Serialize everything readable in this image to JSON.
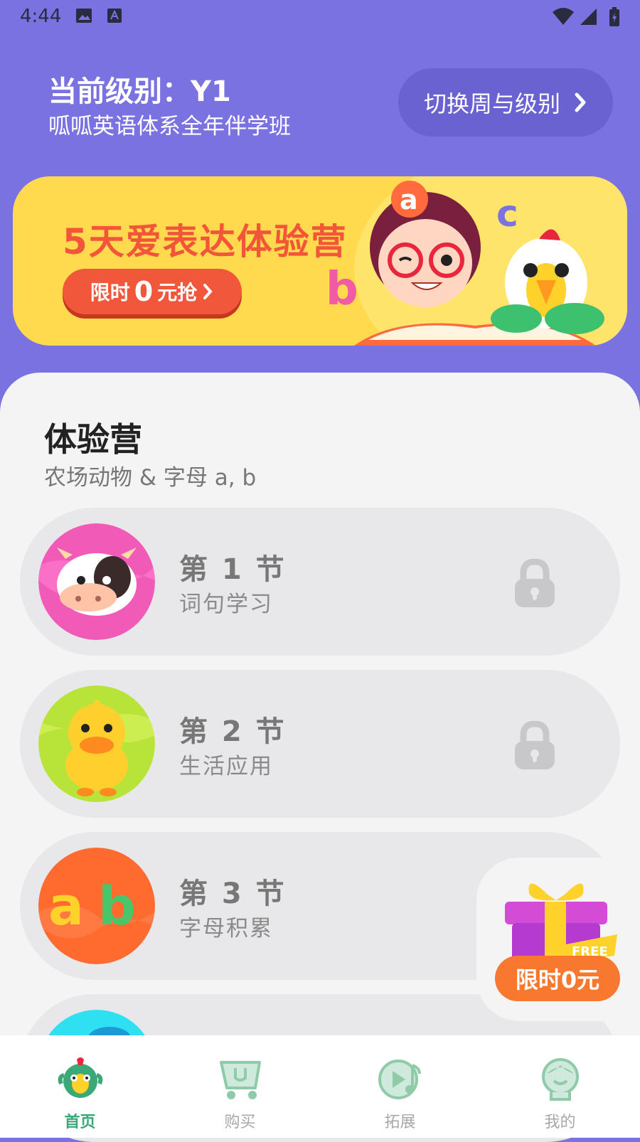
{
  "status_bar": {
    "time": "4:44"
  },
  "header": {
    "level_title": "当前级别：Y1",
    "course_name": "呱呱英语体系全年伴学班",
    "switch_button": "切换周与级别"
  },
  "banner": {
    "title": "5天爱表达体验营",
    "button_prefix": "限时",
    "button_zero": "0",
    "button_suffix": "元抢"
  },
  "section": {
    "title": "体验营",
    "subtitle": "农场动物 & 字母 a, b"
  },
  "lessons": [
    {
      "title": "第 1 节",
      "subtitle": "词句学习",
      "thumb": "cow",
      "locked": true
    },
    {
      "title": "第 2 节",
      "subtitle": "生活应用",
      "thumb": "duck",
      "locked": true
    },
    {
      "title": "第 3 节",
      "subtitle": "字母积累",
      "thumb": "ab-letters",
      "locked": false
    }
  ],
  "gift": {
    "label": "限时0元",
    "tag": "FREE"
  },
  "tabbar": {
    "items": [
      {
        "label": "首页",
        "icon": "parrot-home-icon",
        "active": true
      },
      {
        "label": "购买",
        "icon": "cart-icon",
        "active": false
      },
      {
        "label": "拓展",
        "icon": "play-music-icon",
        "active": false
      },
      {
        "label": "我的",
        "icon": "profile-icon",
        "active": false
      }
    ]
  },
  "colors": {
    "header_bg": "#7b72e2",
    "banner_bg": "#ffd94e",
    "accent_orange": "#f0573b",
    "tab_active": "#3aa877"
  }
}
